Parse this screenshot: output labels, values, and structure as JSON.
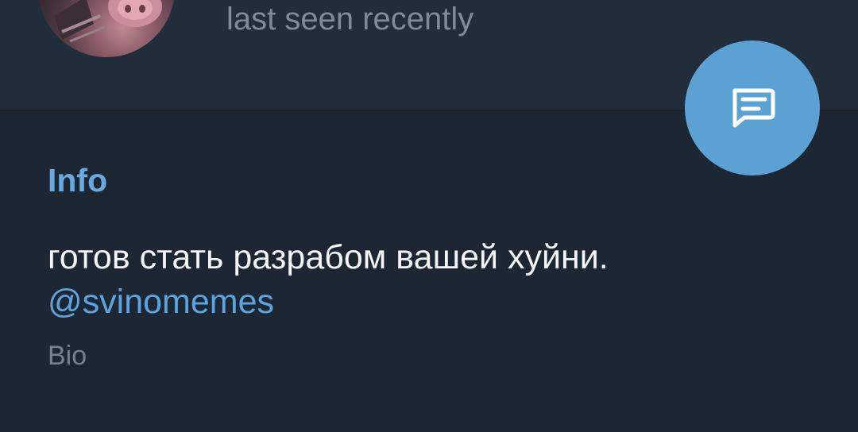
{
  "profile": {
    "status": "last seen recently"
  },
  "fab": {
    "icon": "message-icon",
    "color": "#5ba1d3"
  },
  "info": {
    "title": "Info",
    "bio_text": "готов стать разрабом вашей хуйни.",
    "bio_link": "@svinomemes",
    "bio_label": "Bio"
  },
  "colors": {
    "background": "#1d2733",
    "header": "#212d3b",
    "accent": "#67a9e0",
    "link": "#5ba4e0"
  }
}
